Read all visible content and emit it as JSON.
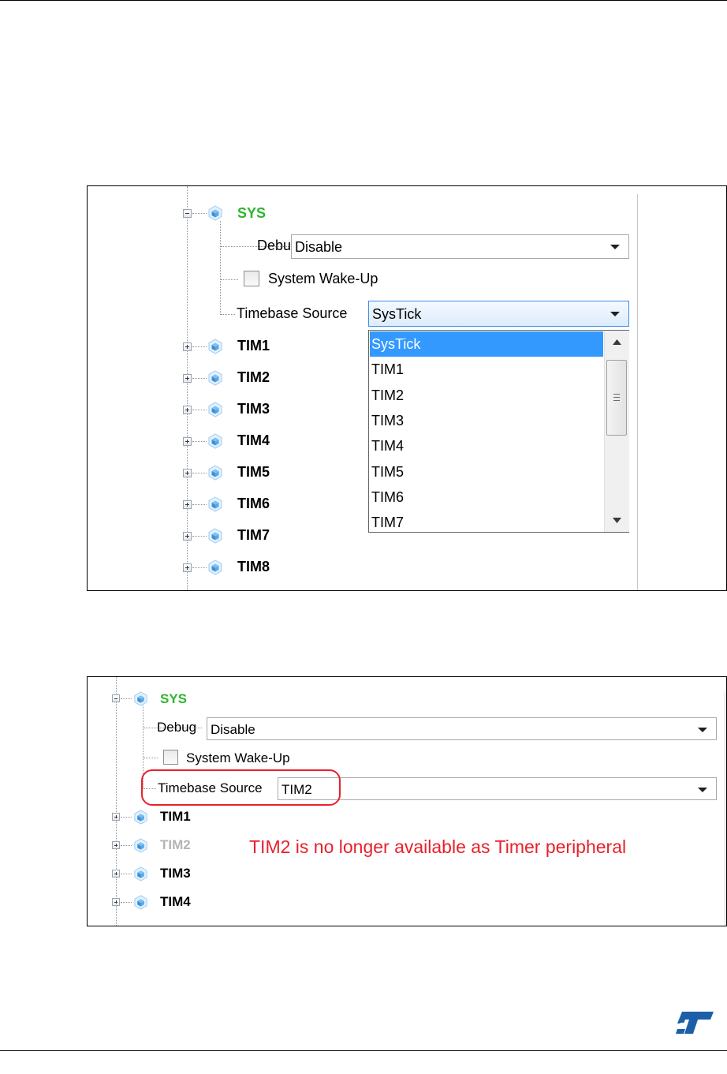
{
  "panel1": {
    "sys_label": "SYS",
    "debug_label": "Debug",
    "debug_value": "Disable",
    "wakeup_label": "System Wake-Up",
    "timebase_label": "Timebase Source",
    "timebase_value": "SysTick",
    "dropdown_options": [
      "SysTick",
      "TIM1",
      "TIM2",
      "TIM3",
      "TIM4",
      "TIM5",
      "TIM6",
      "TIM7"
    ],
    "selected_option": "SysTick",
    "tree_items": [
      "TIM1",
      "TIM2",
      "TIM3",
      "TIM4",
      "TIM5",
      "TIM6",
      "TIM7",
      "TIM8"
    ]
  },
  "panel2": {
    "sys_label": "SYS",
    "debug_label": "Debug",
    "debug_value": "Disable",
    "wakeup_label": "System Wake-Up",
    "timebase_label": "Timebase Source",
    "timebase_value": "TIM2",
    "tree_items": [
      "TIM1",
      "TIM2",
      "TIM3",
      "TIM4"
    ],
    "disabled_item": "TIM2",
    "annotation": "TIM2 is no longer available as Timer peripheral"
  },
  "colors": {
    "sys_green": "#2fb52f",
    "selection_blue": "#3399ff",
    "annotation_red": "#e8202a",
    "disabled_gray": "#b4b4b4",
    "cube_blue": "#5aa8e6"
  },
  "icons": {
    "tree_collapse": "minus-box-icon",
    "tree_expand": "plus-box-icon",
    "peripheral": "cube-icon",
    "combo_arrow": "chevron-down-icon",
    "logo": "st-logo"
  }
}
